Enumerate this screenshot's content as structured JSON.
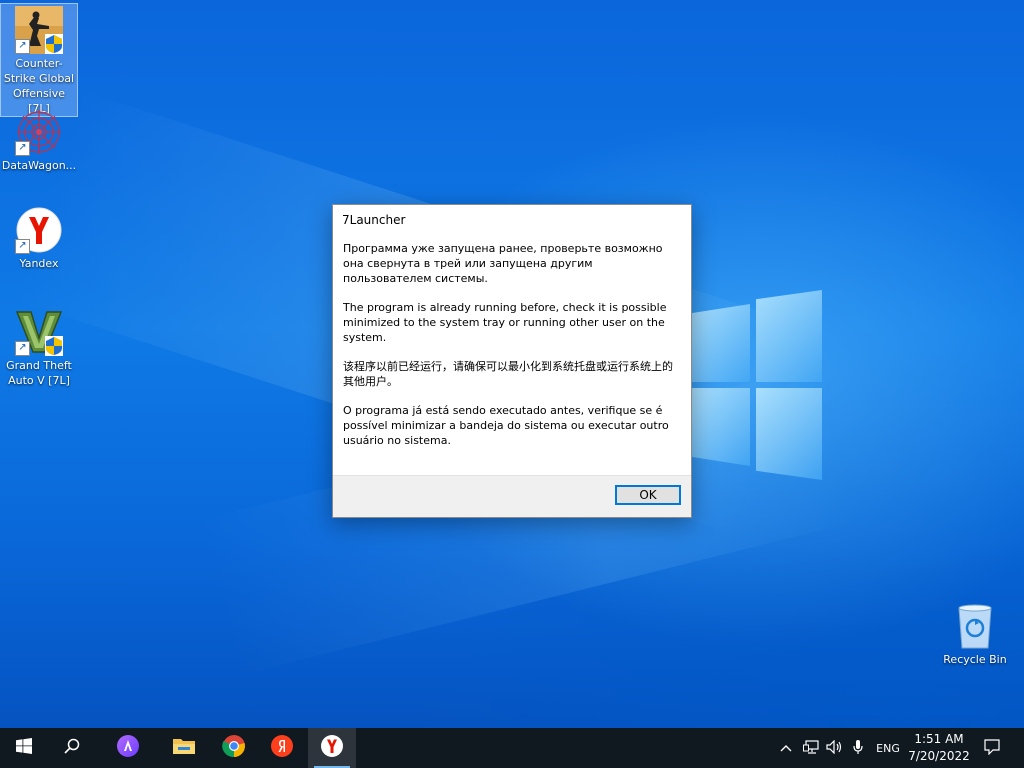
{
  "desktop": {
    "icons": [
      {
        "label": "Counter-Strike Global Offensive [7L]",
        "icon": "csgo-icon"
      },
      {
        "label": "DataWagon...",
        "icon": "datawagon-icon"
      },
      {
        "label": "Yandex",
        "icon": "yandex-browser-icon"
      },
      {
        "label": "Grand Theft Auto V [7L]",
        "icon": "gta-v-icon"
      },
      {
        "label": "Recycle Bin",
        "icon": "recycle-bin-icon"
      }
    ]
  },
  "dialog": {
    "title": "7Launcher",
    "messages": [
      "Программа уже запущена ранее, проверьте возможно она свернута в трей или запущена другим пользователем системы.",
      "The program is already running before, check it is possible minimized to the system tray or running other user on the system.",
      "该程序以前已经运行，请确保可以最小化到系统托盘或运行系统上的其他用户。",
      "O programa já está sendo executado antes, verifique se é possível minimizar a bandeja do sistema ou executar outro usuário no sistema."
    ],
    "ok_label": "OK"
  },
  "taskbar": {
    "pinned": [
      "start-icon",
      "search-icon",
      "alice-icon",
      "file-explorer-icon",
      "chrome-icon",
      "yandex-icon",
      "yandex-browser-icon"
    ],
    "tray": {
      "language": "ENG",
      "time": "1:51 AM",
      "date": "7/20/2022"
    }
  },
  "colors": {
    "accent": "#0078d7",
    "taskbar": "#101820",
    "desktop": "#0a6ad8"
  }
}
